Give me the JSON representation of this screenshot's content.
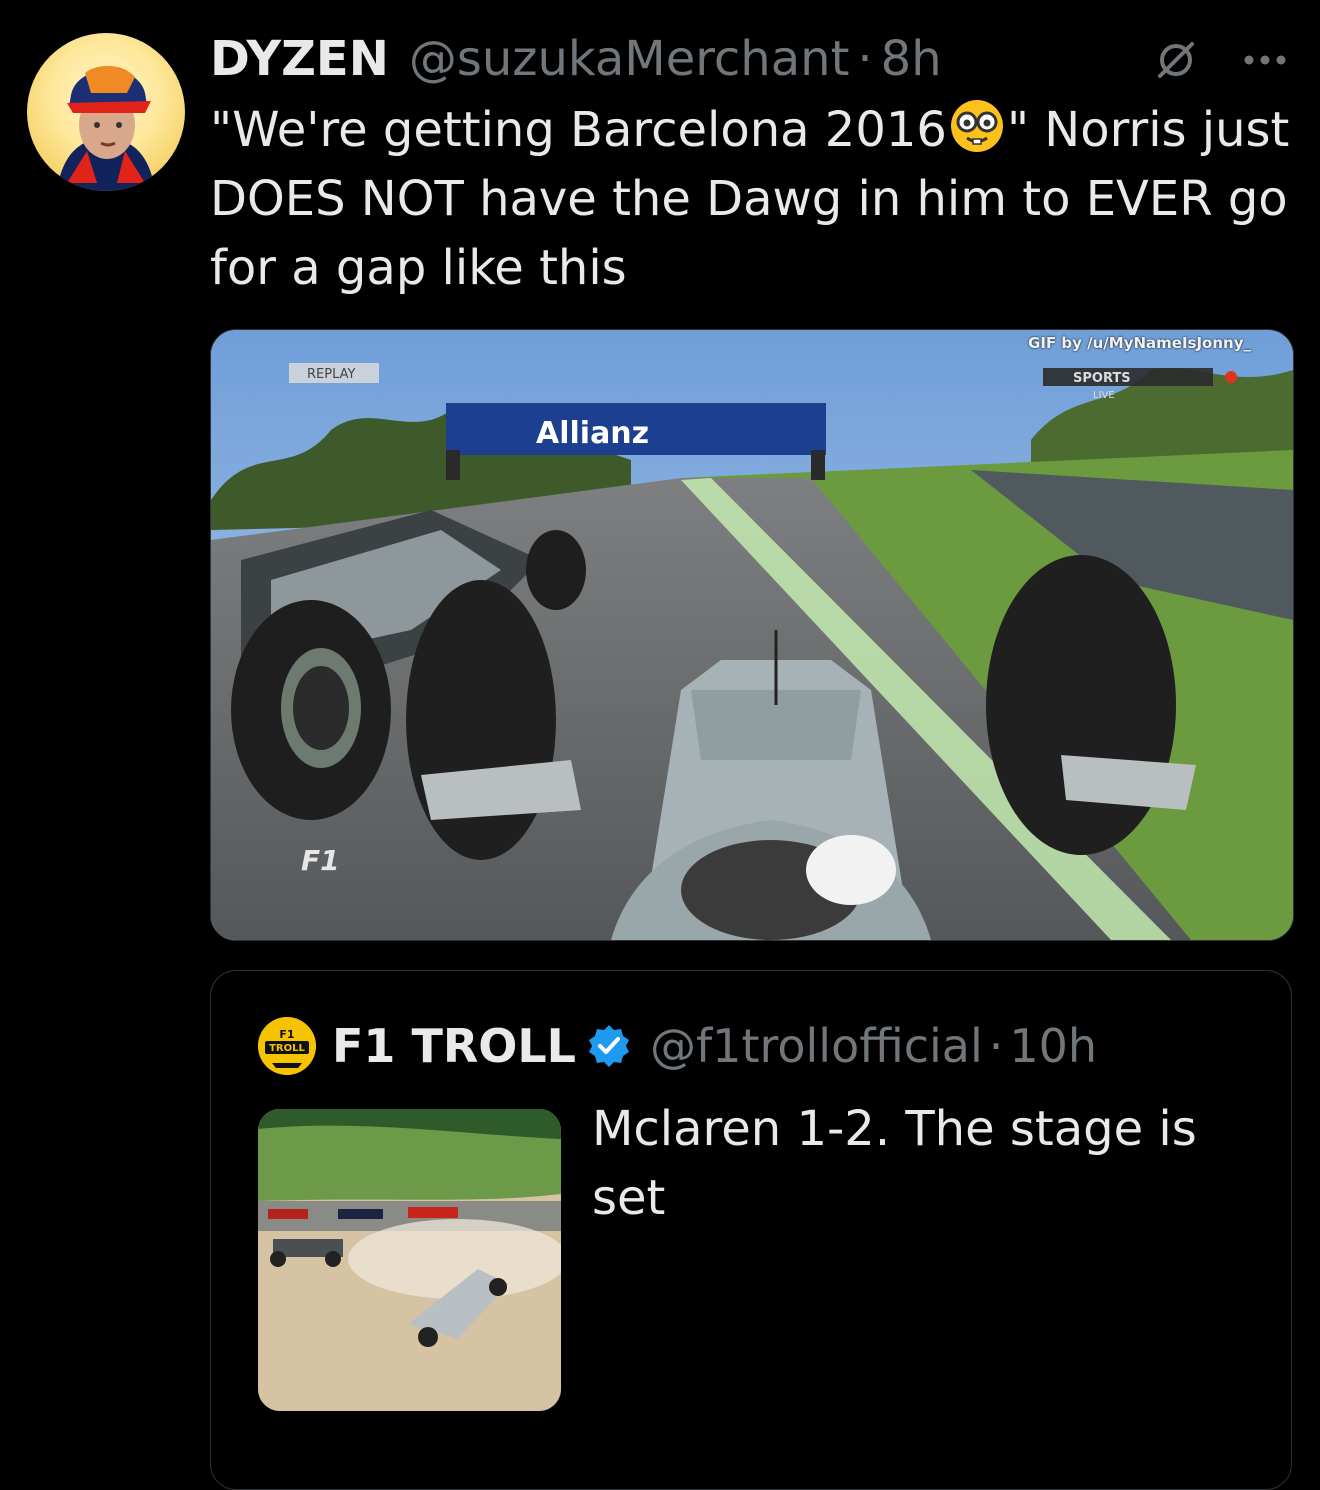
{
  "tweet": {
    "author_name": "DYZEN",
    "handle": "@suzukaMerchant",
    "separator": "·",
    "time": "8h",
    "text_before_emoji": "\"We're getting Barcelona 2016",
    "emoji": "nerd-face-emoji",
    "text_after_emoji": "\" Norris just DOES NOT have the Dawg in him to EVER go for a gap like this",
    "media": {
      "gif_credit": "GIF by /u/MyNameIsJonny_",
      "replay_label": "REPLAY",
      "banner_text": "Allianz",
      "broadcaster": "SPORTS",
      "broadcaster_live": "LIVE"
    }
  },
  "quote": {
    "author_name": "F1 TROLL",
    "avatar_text_1": "F1",
    "avatar_text_2": "TROLL",
    "handle": "@f1trollofficial",
    "separator": "·",
    "time": "10h",
    "text": "Mclaren 1-2. The stage is set"
  },
  "icons": {
    "grok": "grok-icon",
    "more": "more-icon",
    "verified": "verified-badge-icon"
  },
  "colors": {
    "background": "#000000",
    "text_primary": "#e7e9ea",
    "text_secondary": "#71767b",
    "border": "#2f3336",
    "verified": "#1d9bf0"
  }
}
